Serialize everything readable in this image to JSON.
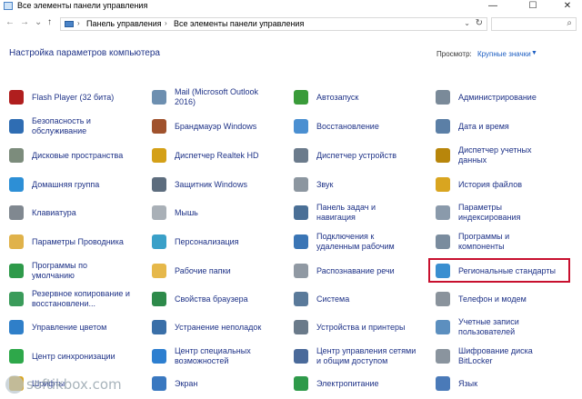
{
  "window": {
    "title": "Все элементы панели управления",
    "minimize": "—",
    "maximize": "☐",
    "close": "✕"
  },
  "nav": {
    "back": "←",
    "forward": "→",
    "recent": "⌄",
    "up": "↑"
  },
  "address": {
    "crumbs": [
      "Панель управления",
      "Все элементы панели управления"
    ],
    "sep": "›",
    "dropdown": "⌄",
    "refresh": "↻"
  },
  "search": {
    "icon": "⌕"
  },
  "heading": "Настройка параметров компьютера",
  "view": {
    "label": "Просмотр:",
    "value": "Крупные значки",
    "arrow": "▼"
  },
  "items": [
    {
      "label": "Flash Player (32 бита)",
      "icon": "flash-icon",
      "color": "#b01e1e"
    },
    {
      "label": "Mail (Microsoft Outlook\n2016)",
      "icon": "mail-icon",
      "color": "#6d8fb0"
    },
    {
      "label": "Автозапуск",
      "icon": "autoplay-icon",
      "color": "#3a9b3a"
    },
    {
      "label": "Администрирование",
      "icon": "admin-tools-icon",
      "color": "#7a8a99"
    },
    {
      "label": "Безопасность и\nобслуживание",
      "icon": "flag-icon",
      "color": "#2f6db3"
    },
    {
      "label": "Брандмауэр Windows",
      "icon": "firewall-icon",
      "color": "#a0522d"
    },
    {
      "label": "Восстановление",
      "icon": "recovery-icon",
      "color": "#4a8fd1"
    },
    {
      "label": "Дата и время",
      "icon": "clock-icon",
      "color": "#5b7fa6"
    },
    {
      "label": "Дисковые пространства",
      "icon": "storage-icon",
      "color": "#7c8c7c"
    },
    {
      "label": "Диспетчер Realtek HD",
      "icon": "speaker-icon",
      "color": "#d4a017"
    },
    {
      "label": "Диспетчер устройств",
      "icon": "device-manager-icon",
      "color": "#6b7b8c"
    },
    {
      "label": "Диспетчер учетных\nданных",
      "icon": "credential-icon",
      "color": "#b8860b"
    },
    {
      "label": "Домашняя группа",
      "icon": "homegroup-icon",
      "color": "#2d8fd6"
    },
    {
      "label": "Защитник Windows",
      "icon": "defender-icon",
      "color": "#5d6d7e"
    },
    {
      "label": "Звук",
      "icon": "sound-icon",
      "color": "#8c96a0"
    },
    {
      "label": "История файлов",
      "icon": "file-history-icon",
      "color": "#d9a520"
    },
    {
      "label": "Клавиатура",
      "icon": "keyboard-icon",
      "color": "#808890"
    },
    {
      "label": "Мышь",
      "icon": "mouse-icon",
      "color": "#a9b0b7"
    },
    {
      "label": "Панель задач и\nнавигация",
      "icon": "taskbar-icon",
      "color": "#4a6f96"
    },
    {
      "label": "Параметры\nиндексирования",
      "icon": "indexing-icon",
      "color": "#8a9aab"
    },
    {
      "label": "Параметры Проводника",
      "icon": "folder-options-icon",
      "color": "#e0b24a"
    },
    {
      "label": "Персонализация",
      "icon": "personalization-icon",
      "color": "#3aa0c8"
    },
    {
      "label": "Подключения к\nудаленным рабочим",
      "icon": "remote-icon",
      "color": "#3a75b5"
    },
    {
      "label": "Программы и\nкомпоненты",
      "icon": "programs-icon",
      "color": "#7a8c9e"
    },
    {
      "label": "Программы по\nумолчанию",
      "icon": "default-programs-icon",
      "color": "#2e9a4a"
    },
    {
      "label": "Рабочие папки",
      "icon": "work-folders-icon",
      "color": "#e6b84a"
    },
    {
      "label": "Распознавание речи",
      "icon": "microphone-icon",
      "color": "#9099a3"
    },
    {
      "label": "Региональные стандарты",
      "icon": "globe-icon",
      "color": "#3a8fd0"
    },
    {
      "label": "Резервное копирование и\nвосстановлени...",
      "icon": "backup-icon",
      "color": "#3a9b5a"
    },
    {
      "label": "Свойства браузера",
      "icon": "internet-options-icon",
      "color": "#2d8a4a"
    },
    {
      "label": "Система",
      "icon": "system-icon",
      "color": "#5a7a9a"
    },
    {
      "label": "Телефон и модем",
      "icon": "phone-icon",
      "color": "#8a939c"
    },
    {
      "label": "Управление цветом",
      "icon": "color-management-icon",
      "color": "#2f7fc9"
    },
    {
      "label": "Устранение неполадок",
      "icon": "troubleshoot-icon",
      "color": "#3a6fa8"
    },
    {
      "label": "Устройства и принтеры",
      "icon": "printer-icon",
      "color": "#6a7a8a"
    },
    {
      "label": "Учетные записи\nпользователей",
      "icon": "users-icon",
      "color": "#5c8fbf"
    },
    {
      "label": "Центр синхронизации",
      "icon": "sync-icon",
      "color": "#2ea84a"
    },
    {
      "label": "Центр специальных\nвозможностей",
      "icon": "accessibility-icon",
      "color": "#2d7fd0"
    },
    {
      "label": "Центр управления сетями\nи общим доступом",
      "icon": "network-icon",
      "color": "#4a6a9a"
    },
    {
      "label": "Шифрование диска\nBitLocker",
      "icon": "bitlocker-icon",
      "color": "#8a949e"
    },
    {
      "label": "Шрифты",
      "icon": "fonts-icon",
      "color": "#d9a520"
    },
    {
      "label": "Экран",
      "icon": "display-icon",
      "color": "#3a78c0"
    },
    {
      "label": "Электропитание",
      "icon": "power-icon",
      "color": "#2e9a4a"
    },
    {
      "label": "Язык",
      "icon": "language-icon",
      "color": "#4a7ab8"
    }
  ],
  "watermark": "softikbox.com"
}
